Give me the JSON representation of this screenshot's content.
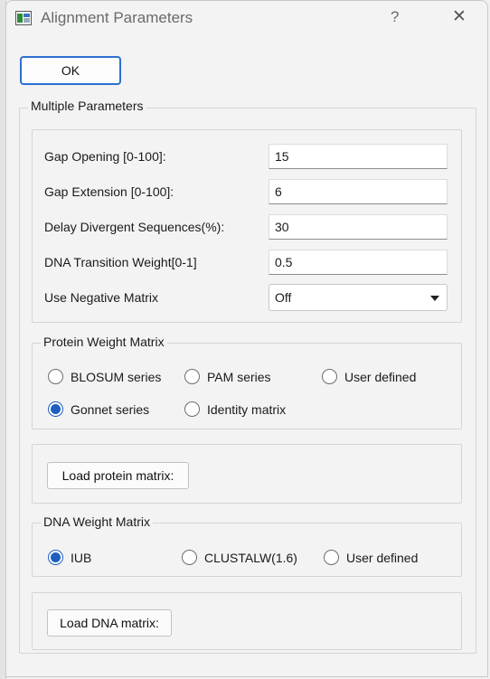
{
  "window": {
    "title": "Alignment Parameters",
    "help_label": "?",
    "close_label": "✕"
  },
  "ok_label": "OK",
  "multiple": {
    "legend": "Multiple Parameters",
    "fields": [
      {
        "label": "Gap Opening [0-100]:",
        "value": "15"
      },
      {
        "label": "Gap Extension [0-100]:",
        "value": "6"
      },
      {
        "label": "Delay Divergent Sequences(%):",
        "value": "30"
      },
      {
        "label": "DNA Transition Weight[0-1]",
        "value": "0.5"
      }
    ],
    "negative_matrix": {
      "label": "Use Negative Matrix",
      "value": "Off"
    }
  },
  "protein": {
    "legend": "Protein Weight Matrix",
    "options": [
      {
        "label": "BLOSUM series",
        "selected": false
      },
      {
        "label": "PAM series",
        "selected": false
      },
      {
        "label": "User defined",
        "selected": false
      },
      {
        "label": "Gonnet series",
        "selected": true
      },
      {
        "label": "Identity matrix",
        "selected": false
      }
    ],
    "load_label": "Load protein matrix:"
  },
  "dna": {
    "legend": "DNA Weight Matrix",
    "options": [
      {
        "label": "IUB",
        "selected": true
      },
      {
        "label": "CLUSTALW(1.6)",
        "selected": false
      },
      {
        "label": "User defined",
        "selected": false
      }
    ],
    "load_label": "Load DNA matrix:"
  },
  "colors": {
    "accent": "#1f5fbf",
    "focus_border": "#2d6fd0"
  },
  "icons": {
    "app": "app-window-icon",
    "close": "close-icon",
    "help": "help-icon",
    "dropdown": "chevron-down-icon"
  }
}
